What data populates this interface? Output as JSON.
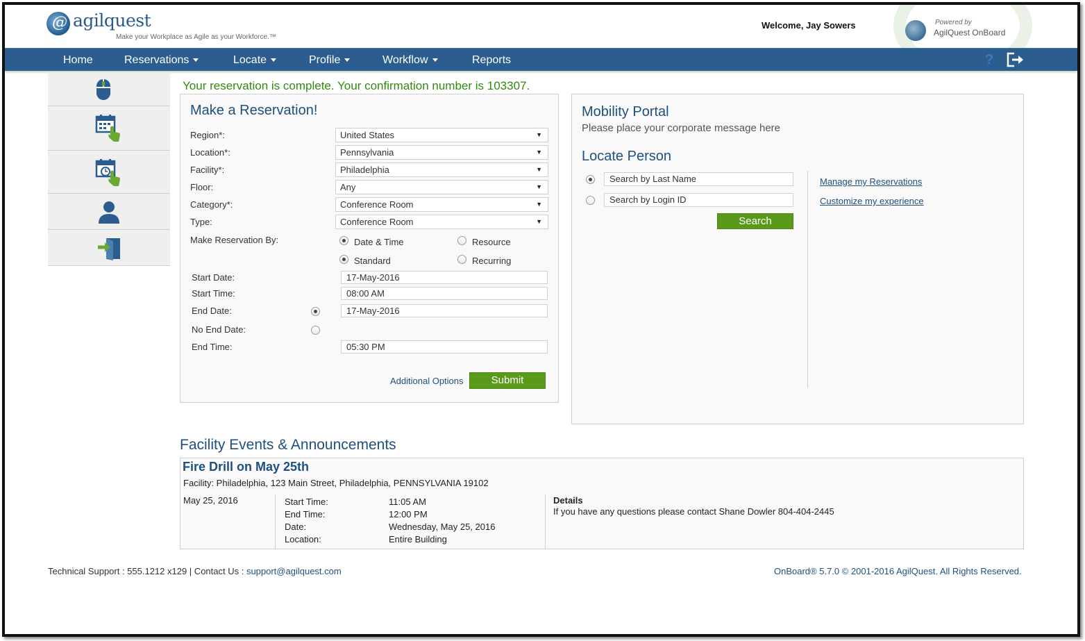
{
  "header": {
    "logo_name": "agilquest",
    "logo_tagline": "Make your Workplace as Agile as your Workforce.™",
    "welcome": "Welcome, Jay  Sowers",
    "powered_by": "Powered by",
    "powered_product": "AgilQuest OnBoard"
  },
  "nav": {
    "items": [
      {
        "label": "Home"
      },
      {
        "label": "Reservations"
      },
      {
        "label": "Locate"
      },
      {
        "label": "Profile"
      },
      {
        "label": "Workflow"
      },
      {
        "label": "Reports"
      }
    ],
    "help": "?"
  },
  "sidebar": {
    "icons": [
      "mouse-icon",
      "calendar-touch-icon",
      "calendar-clock-icon",
      "person-icon",
      "exit-door-icon"
    ]
  },
  "confirmation": "Your reservation is complete. Your confirmation number is 103307.",
  "reservation": {
    "title": "Make a Reservation!",
    "fields": {
      "region": {
        "label": "Region*:",
        "value": "United States"
      },
      "location": {
        "label": "Location*:",
        "value": "Pennsylvania"
      },
      "facility": {
        "label": "Facility*:",
        "value": "Philadelphia"
      },
      "floor": {
        "label": "Floor:",
        "value": "Any"
      },
      "category": {
        "label": "Category*:",
        "value": "Conference Room"
      },
      "type": {
        "label": "Type:",
        "value": "Conference Room"
      }
    },
    "by_label": "Make Reservation By:",
    "by_options": {
      "date_time": "Date & Time",
      "resource": "Resource",
      "standard": "Standard",
      "recurring": "Recurring"
    },
    "start_date": {
      "label": "Start Date:",
      "value": "17-May-2016"
    },
    "start_time": {
      "label": "Start Time:",
      "value": "08:00 AM"
    },
    "end_date": {
      "label": "End Date:",
      "value": "17-May-2016"
    },
    "no_end_date": {
      "label": "No End Date:"
    },
    "end_time": {
      "label": "End Time:",
      "value": "05:30 PM"
    },
    "additional_options": "Additional Options",
    "submit": "Submit"
  },
  "mobility": {
    "title": "Mobility Portal",
    "message": "Please place your corporate message here",
    "locate_title": "Locate Person",
    "search_last_name": "Search by Last Name",
    "search_login_id": "Search by Login ID",
    "search_button": "Search",
    "manage_link": "Manage my Reservations",
    "customize_link": "Customize my experience"
  },
  "events": {
    "section_title": "Facility Events & Announcements",
    "event_title": "Fire Drill on May 25th",
    "facility_line": "Facility: Philadelphia, 123 Main Street, Philadelphia, PENNSYLVANIA 19102",
    "date": "May 25, 2016",
    "start_time_label": "Start Time:",
    "start_time": "11:05 AM",
    "end_time_label": "End Time:",
    "end_time": "12:00 PM",
    "date_label": "Date:",
    "date_full": "Wednesday, May 25, 2016",
    "location_label": "Location:",
    "location": "Entire Building",
    "details_label": "Details",
    "details": "If you have any questions please contact Shane Dowler 804-404-2445"
  },
  "footer": {
    "support": "Technical Support : 555.1212 x129 | Contact Us : ",
    "email": "support@agilquest.com",
    "copyright": "OnBoard® 5.7.0 © 2001-2016 AgilQuest. All Rights Reserved."
  },
  "colors": {
    "nav_bg": "#2c5d8f",
    "accent_green": "#5a9a1a",
    "confirm_green": "#2e8b0f",
    "title_blue": "#1f4f7d"
  }
}
